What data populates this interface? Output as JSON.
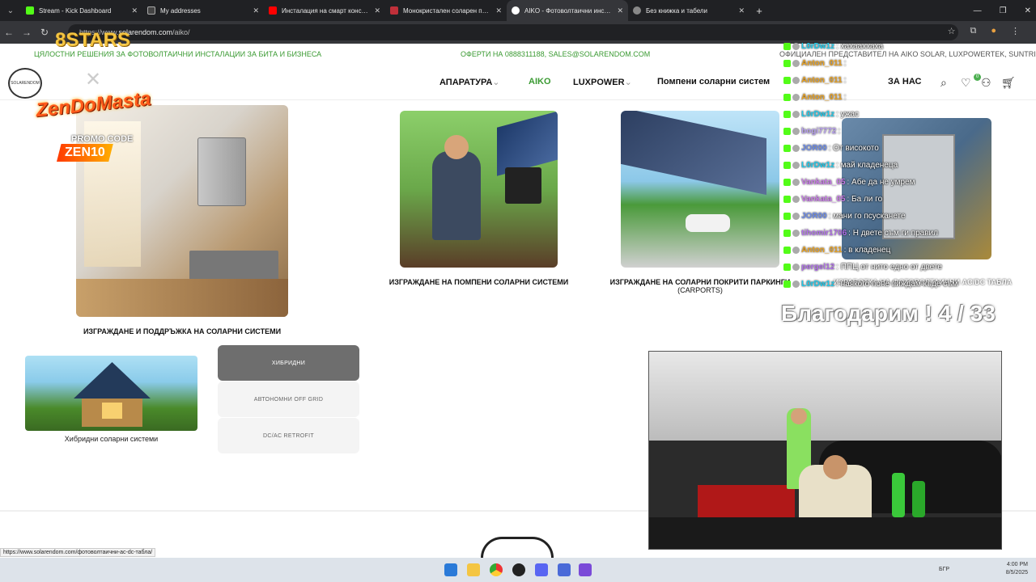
{
  "browser": {
    "tabs": [
      {
        "title": "Stream - Kick Dashboard",
        "color": "#53fc18",
        "active": false
      },
      {
        "title": "My addresses",
        "color": "#444",
        "active": false
      },
      {
        "title": "Инсталация на смарт констру...",
        "color": "#ff0000",
        "active": false
      },
      {
        "title": "Монокристален соларен пане...",
        "color": "#c0303a",
        "active": false
      },
      {
        "title": "AIKO - Фотоволтаични инстал...",
        "color": "#ffffff",
        "active": true
      },
      {
        "title": "Без книжка и табели",
        "color": "#888",
        "active": false
      }
    ],
    "new_tab": "+",
    "url": "https://www.solarendom.com/aiko/",
    "url_prefix": "https://www.",
    "url_host": "solarendom.com",
    "url_path": "/aiko/"
  },
  "site": {
    "strip_left": "ЦЯЛОСТНИ РЕШЕНИЯ ЗА ФОТОВОЛТАИЧНИ ИНСТАЛАЦИИ ЗА БИТА И БИЗНЕСА",
    "strip_center": "ОФЕРТИ НА 0888311188, SALES@SOLARENDOM.COM",
    "strip_right": "ОФИЦИАЛЕН ПРЕДСТАВИТЕЛ НА AIKO SOLAR, LUXPOWERTEK, SUNTRI",
    "logo": "SOLARENDOM",
    "nav": [
      {
        "label": "АПАРАТУРА",
        "dropdown": "⌄"
      },
      {
        "label": "AIKO"
      },
      {
        "label": "LUXPOWER",
        "dropdown": "⌄"
      },
      {
        "label": "Помпени соларни систем"
      },
      {
        "label": "ЗА НАС"
      }
    ],
    "wishlist_count": "0",
    "cards": [
      {
        "caption": "ИЗГРАЖДАНЕ И ПОДДРЪЖКА НА СОЛАРНИ СИСТЕМИ"
      },
      {
        "caption": "ИЗГРАЖДАНЕ НА ПОМПЕНИ СОЛАРНИ СИСТЕМИ"
      },
      {
        "caption_line1": "ИЗГРАЖДАНЕ НА СОЛАРНИ ПОКРИТИ ПАРКИНГИ",
        "caption_line2": "(CARPORTS)"
      },
      {
        "caption": "ИЗРАБОТКА НА ФОТОВОЛТАИЧНИ AC/DC ТАБЛА"
      }
    ],
    "small_card": {
      "caption": "Хибридни соларни системи"
    },
    "buttons": [
      "ХИБРИДНИ",
      "АВТОНОМНИ OFF GRID",
      "DC/AC RETROFIT"
    ]
  },
  "status_url": "https://www.solarendom.com/фотоволтаични-ac-dc-табла/",
  "overlay": {
    "brand": "8STARS",
    "promo_name": "ZenDoMasta",
    "promo_label": "PROMO CODE",
    "promo_code": "ZEN10",
    "chat": [
      {
        "user": "L0rDw1z",
        "msg": ": хахааххаха"
      },
      {
        "user": "Anton_011",
        "msg": ":"
      },
      {
        "user": "Anton_011",
        "msg": ":"
      },
      {
        "user": "Anton_011",
        "msg": ":"
      },
      {
        "user": "L0rDw1z",
        "msg": ": ужас"
      },
      {
        "user": "bogi7772",
        "msg": ":"
      },
      {
        "user": "JOR00",
        "msg": ": От високото"
      },
      {
        "user": "L0rDw1z",
        "msg": ": май кладенеца"
      },
      {
        "user": "Vankata_05",
        "msg": ": Абе да не умрем"
      },
      {
        "user": "Vankata_05",
        "msg": ": Ба ли го"
      },
      {
        "user": "JOR00",
        "msg": ": мани го псусканете"
      },
      {
        "user": "tihomir1706",
        "msg": ": Н двете съм ги правил"
      },
      {
        "user": "Anton_011",
        "msg": ": в кладенец"
      },
      {
        "user": "pergel12",
        "msg": ": ППЦ от нито едно от двете"
      },
      {
        "user": "L0rDw1z",
        "msg": ": наякого поне виждам къде съм"
      }
    ],
    "thanks": "Благодарим ! 4 / 33"
  },
  "taskbar": {
    "lang": "БГР",
    "time": "4:00 PM",
    "date": "8/5/2025"
  },
  "colors": {
    "accent": "#3a9a32",
    "tab_bg": "#202124"
  }
}
